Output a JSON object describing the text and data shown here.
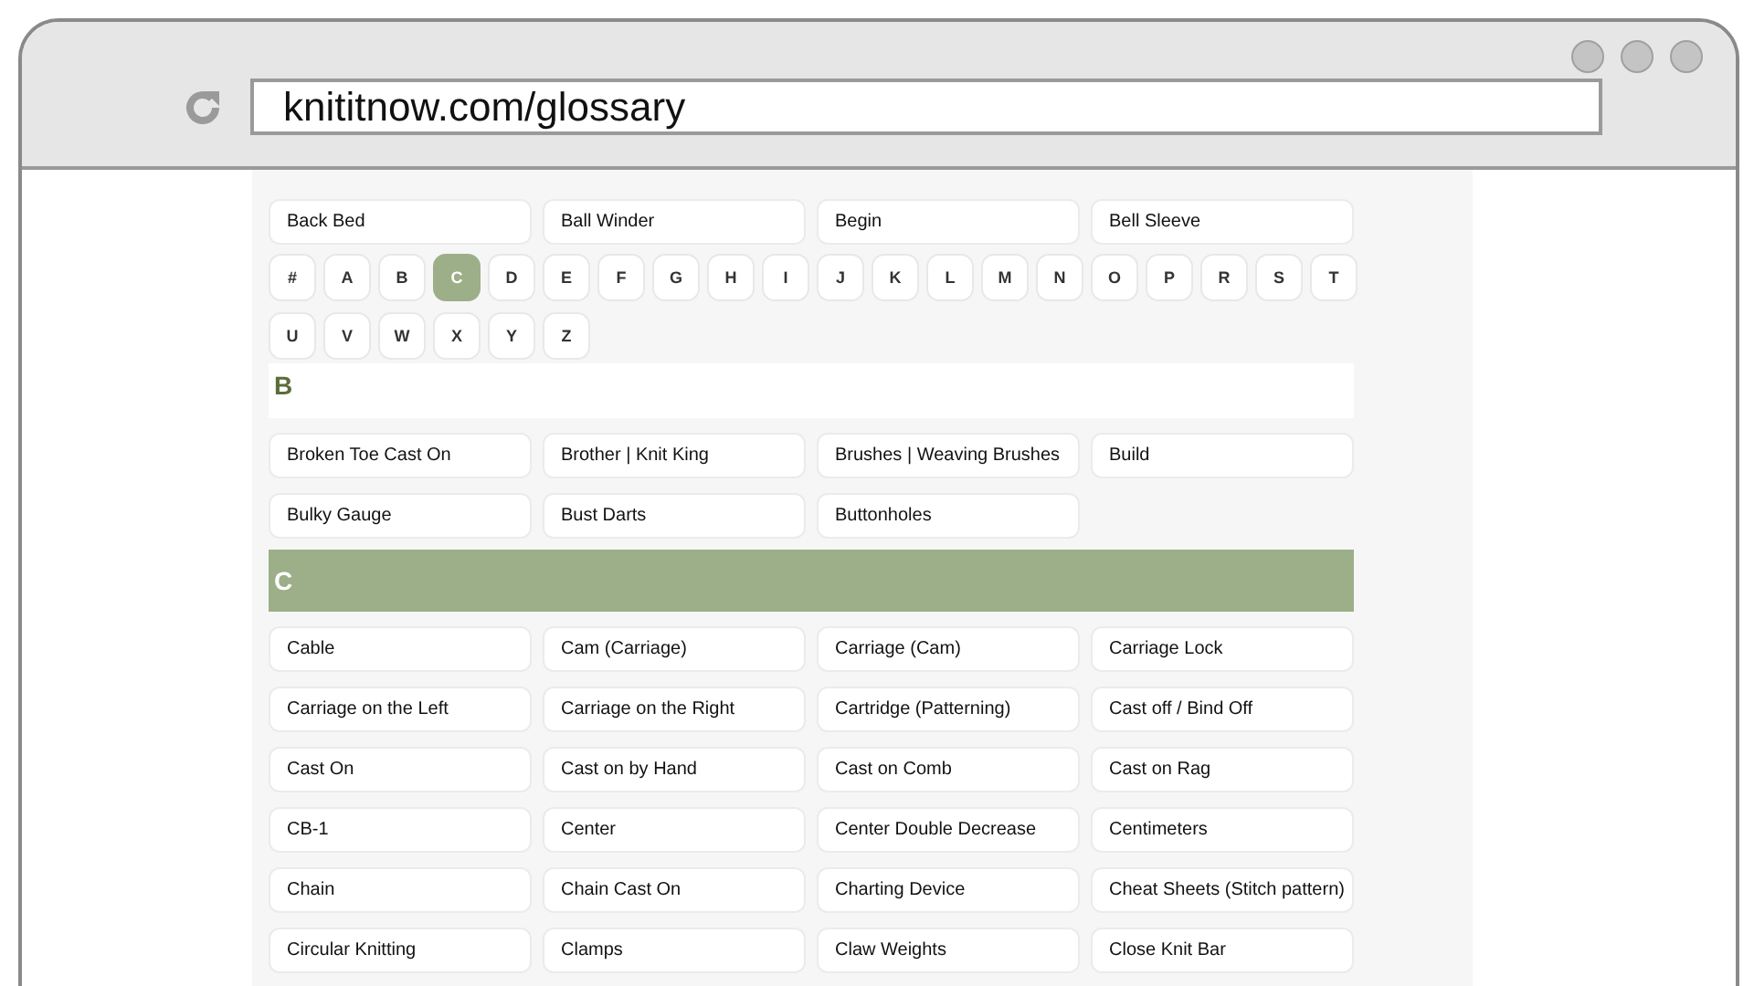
{
  "browser": {
    "url": "knititnow.com/glossary"
  },
  "top_terms": [
    "Back Bed",
    "Ball Winder",
    "Begin",
    "Bell Sleeve"
  ],
  "letters": [
    {
      "label": "#",
      "selected": false
    },
    {
      "label": "A",
      "selected": false
    },
    {
      "label": "B",
      "selected": false
    },
    {
      "label": "C",
      "selected": true
    },
    {
      "label": "D",
      "selected": false
    },
    {
      "label": "E",
      "selected": false
    },
    {
      "label": "F",
      "selected": false
    },
    {
      "label": "G",
      "selected": false
    },
    {
      "label": "H",
      "selected": false
    },
    {
      "label": "I",
      "selected": false
    },
    {
      "label": "J",
      "selected": false
    },
    {
      "label": "K",
      "selected": false
    },
    {
      "label": "L",
      "selected": false
    },
    {
      "label": "M",
      "selected": false
    },
    {
      "label": "N",
      "selected": false
    },
    {
      "label": "O",
      "selected": false
    },
    {
      "label": "P",
      "selected": false
    },
    {
      "label": "R",
      "selected": false
    },
    {
      "label": "S",
      "selected": false
    },
    {
      "label": "T",
      "selected": false
    },
    {
      "label": "U",
      "selected": false
    },
    {
      "label": "V",
      "selected": false
    },
    {
      "label": "W",
      "selected": false
    },
    {
      "label": "X",
      "selected": false
    },
    {
      "label": "Y",
      "selected": false
    },
    {
      "label": "Z",
      "selected": false
    }
  ],
  "sections": [
    {
      "letter": "B",
      "kind": "sticky",
      "terms": [
        "Broken Toe Cast On",
        "Brother | Knit King",
        "Brushes | Weaving Brushes",
        "Build",
        "Bulky Gauge",
        "Bust Darts",
        "Buttonholes"
      ]
    },
    {
      "letter": "C",
      "kind": "banner",
      "terms": [
        "Cable",
        "Cam (Carriage)",
        "Carriage (Cam)",
        "Carriage Lock",
        "Carriage on the Left",
        "Carriage on the Right",
        "Cartridge (Patterning)",
        "Cast off / Bind Off",
        "Cast On",
        "Cast on by Hand",
        "Cast on Comb",
        "Cast on Rag",
        "CB-1",
        "Center",
        "Center Double Decrease",
        "Centimeters",
        "Chain",
        "Chain Cast On",
        "Charting Device",
        "Cheat Sheets (Stitch pattern)",
        "Circular Knitting",
        "Clamps",
        "Claw Weights",
        "Close Knit Bar"
      ]
    }
  ]
}
